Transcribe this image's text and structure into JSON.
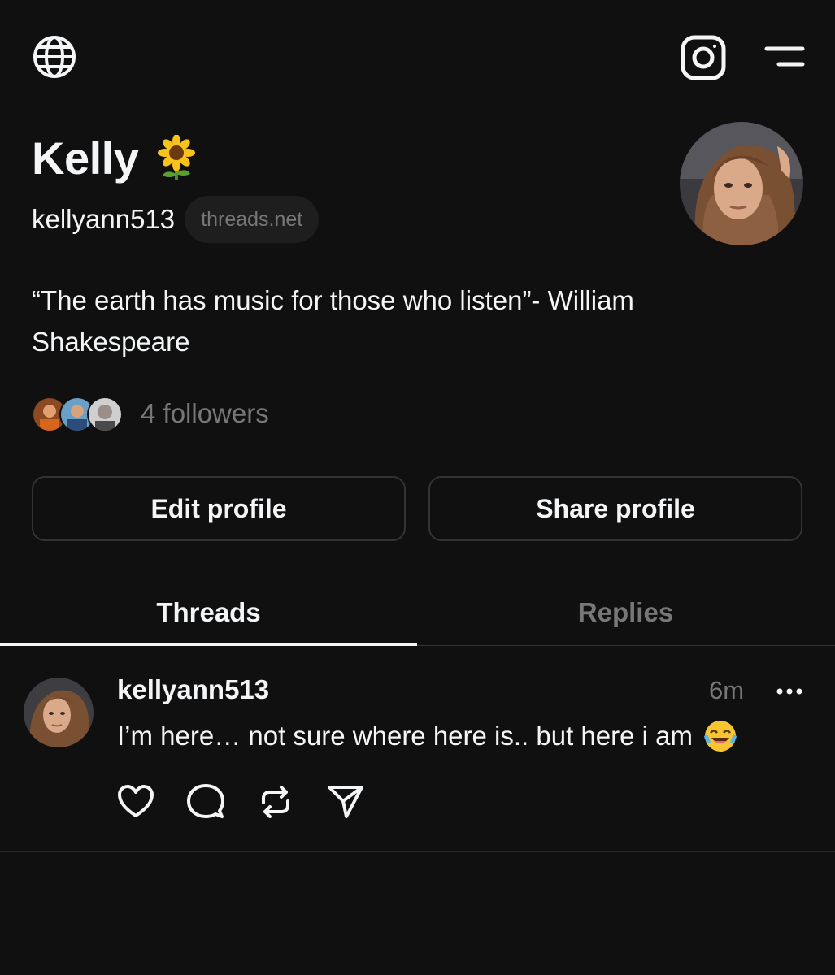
{
  "profile": {
    "display_name": "Kelly",
    "name_emoji": "sunflower",
    "handle": "kellyann513",
    "domain_badge": "threads.net",
    "bio": "“The earth has music for those who listen”- William Shakespeare",
    "followers_text": "4 followers"
  },
  "buttons": {
    "edit": "Edit profile",
    "share": "Share profile"
  },
  "tabs": [
    {
      "label": "Threads",
      "active": true
    },
    {
      "label": "Replies",
      "active": false
    }
  ],
  "post": {
    "username": "kellyann513",
    "time": "6m",
    "text": "I’m here… not sure where here is.. but here i am",
    "emoji": "face-with-tears-of-joy"
  },
  "icons": {
    "globe": "globe-icon",
    "instagram": "instagram-icon",
    "menu": "menu-icon",
    "more": "more-icon",
    "like": "heart-icon",
    "comment": "comment-icon",
    "repost": "repost-icon",
    "share": "send-icon"
  },
  "colors": {
    "background": "#101010",
    "text": "#f3f5f7",
    "muted": "#777777",
    "border": "#333333"
  }
}
